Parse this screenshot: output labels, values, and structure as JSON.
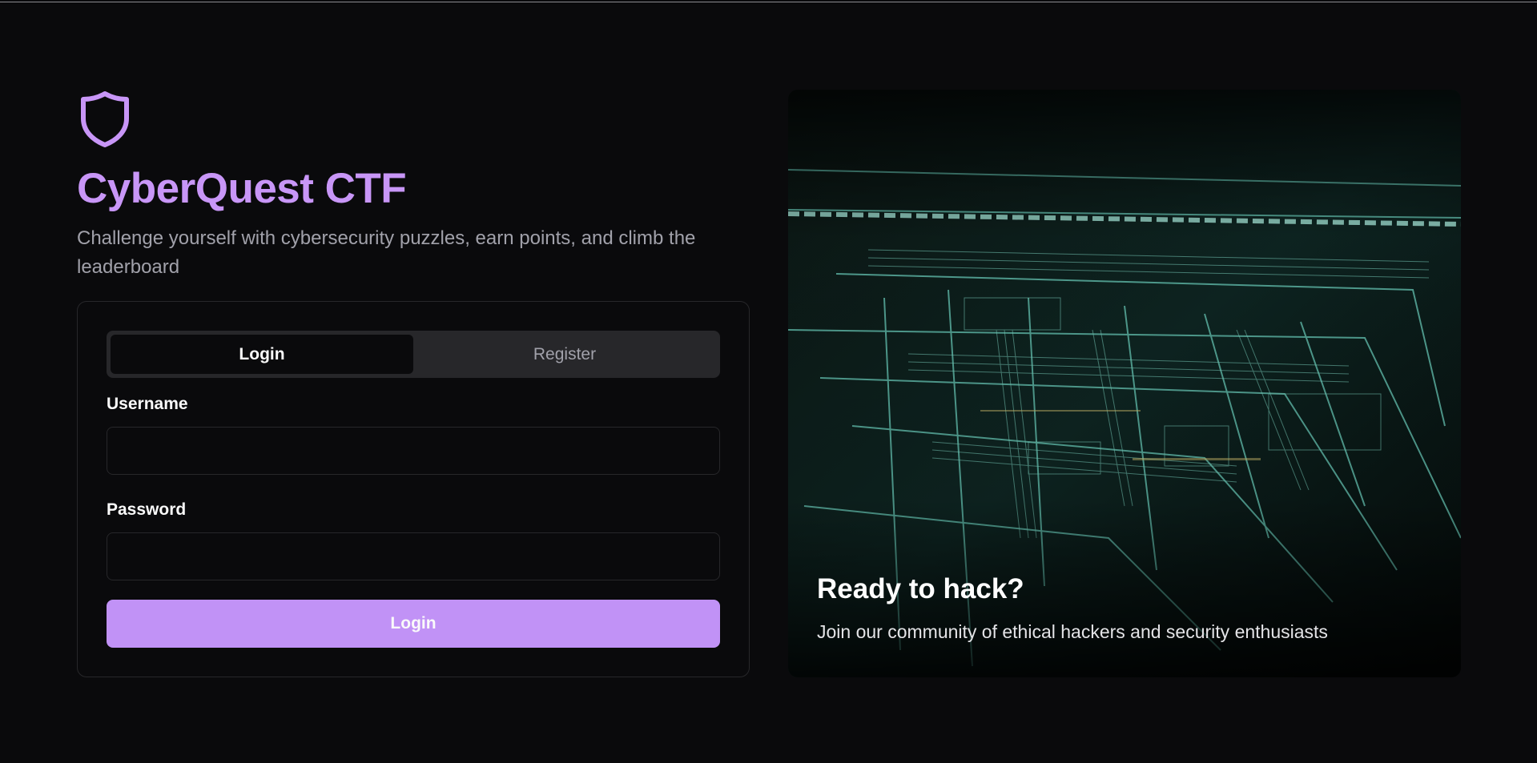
{
  "brand": {
    "icon": "shield-icon",
    "title": "CyberQuest CTF",
    "subtitle": "Challenge yourself with cybersecurity puzzles, earn points, and climb the leaderboard",
    "accent_color": "#c896f7"
  },
  "auth": {
    "tabs": [
      {
        "label": "Login",
        "active": true
      },
      {
        "label": "Register",
        "active": false
      }
    ],
    "username": {
      "label": "Username",
      "value": "",
      "placeholder": ""
    },
    "password": {
      "label": "Password",
      "value": "",
      "placeholder": ""
    },
    "submit_label": "Login",
    "submit_color": "#c192f6"
  },
  "hero": {
    "image": "circuit-board-image",
    "title": "Ready to hack?",
    "subtitle": "Join our community of ethical hackers and security enthusiasts"
  }
}
